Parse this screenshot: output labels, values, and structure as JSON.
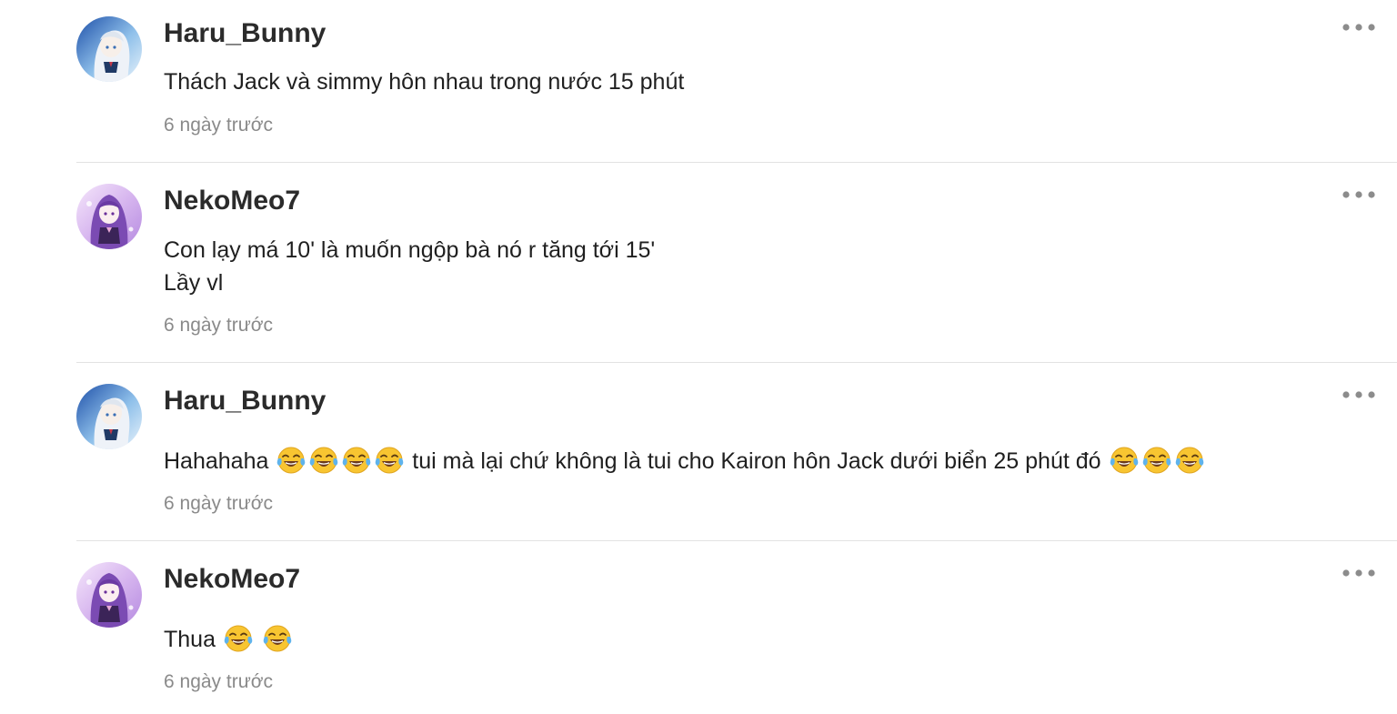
{
  "comments": [
    {
      "username": "Haru_Bunny",
      "avatar_icon": "anime-avatar-blue-icon",
      "lines": [
        "Thách Jack và simmy hôn nhau trong nước 15 phút"
      ],
      "timestamp": "6 ngày trước"
    },
    {
      "username": "NekoMeo7",
      "avatar_icon": "anime-avatar-purple-icon",
      "lines": [
        "Con lạy má 10' là muốn ngộp bà nó r tăng tới 15'",
        "Lầy vl"
      ],
      "timestamp": "6 ngày trước"
    },
    {
      "username": "Haru_Bunny",
      "avatar_icon": "anime-avatar-blue-icon",
      "text_start": "Hahahaha",
      "text_middle": "tui mà lại chứ không là tui cho Kairon hôn Jack dưới biển 25 phút đó",
      "emoji_name": "face-with-tears-of-joy",
      "timestamp": "6 ngày trước"
    },
    {
      "username": "NekoMeo7",
      "avatar_icon": "anime-avatar-purple-icon",
      "text_start": "Thua",
      "emoji_name": "face-with-tears-of-joy",
      "timestamp": "6 ngày trước"
    }
  ],
  "more_icon": "more-horizontal-icon",
  "colors": {
    "username": "#2b2b2b",
    "timestamp": "#8a8a8a",
    "divider": "#e2e2e2",
    "more_dots": "#8c8c8c"
  }
}
